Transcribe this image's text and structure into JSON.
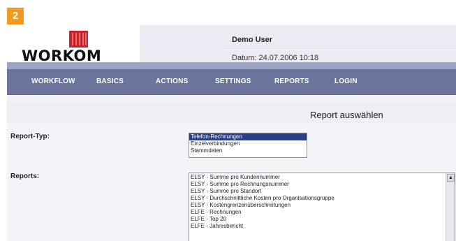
{
  "step_badge": "2",
  "header": {
    "logo_text": "WORKOM",
    "user": "Demo User",
    "date_line": "Datum: 24.07.2006 10:18"
  },
  "nav": {
    "items": [
      "WORKFLOW",
      "BASICS",
      "ACTIONS",
      "SETTINGS",
      "REPORTS",
      "LOGIN"
    ]
  },
  "page_title": "Report auswählen",
  "report_type": {
    "label": "Report-Typ:",
    "options": [
      "Telefon-Rechnungen",
      "Einzelverbindungen",
      "Stammdaten"
    ],
    "selected_index": 0
  },
  "reports": {
    "label": "Reports:",
    "options": [
      "ELSY - Summe pro Kundennummer",
      "ELSY - Summe pro Rechnungsnummer",
      "ELSY - Summe pro Standort",
      "ELSY - Durchschnittliche Kosten pro Organisationsgruppe",
      "ELSY - Kostengrenzenüberschreitungen",
      "ELFE - Rechnungen",
      "ELFE - Top 20",
      "ELFE - Jahresbericht"
    ]
  },
  "colors": {
    "badge": "#f39a1e",
    "nav_bg": "#6b759c",
    "selection": "#2a3f8a",
    "logo_red": "#c8232c"
  }
}
